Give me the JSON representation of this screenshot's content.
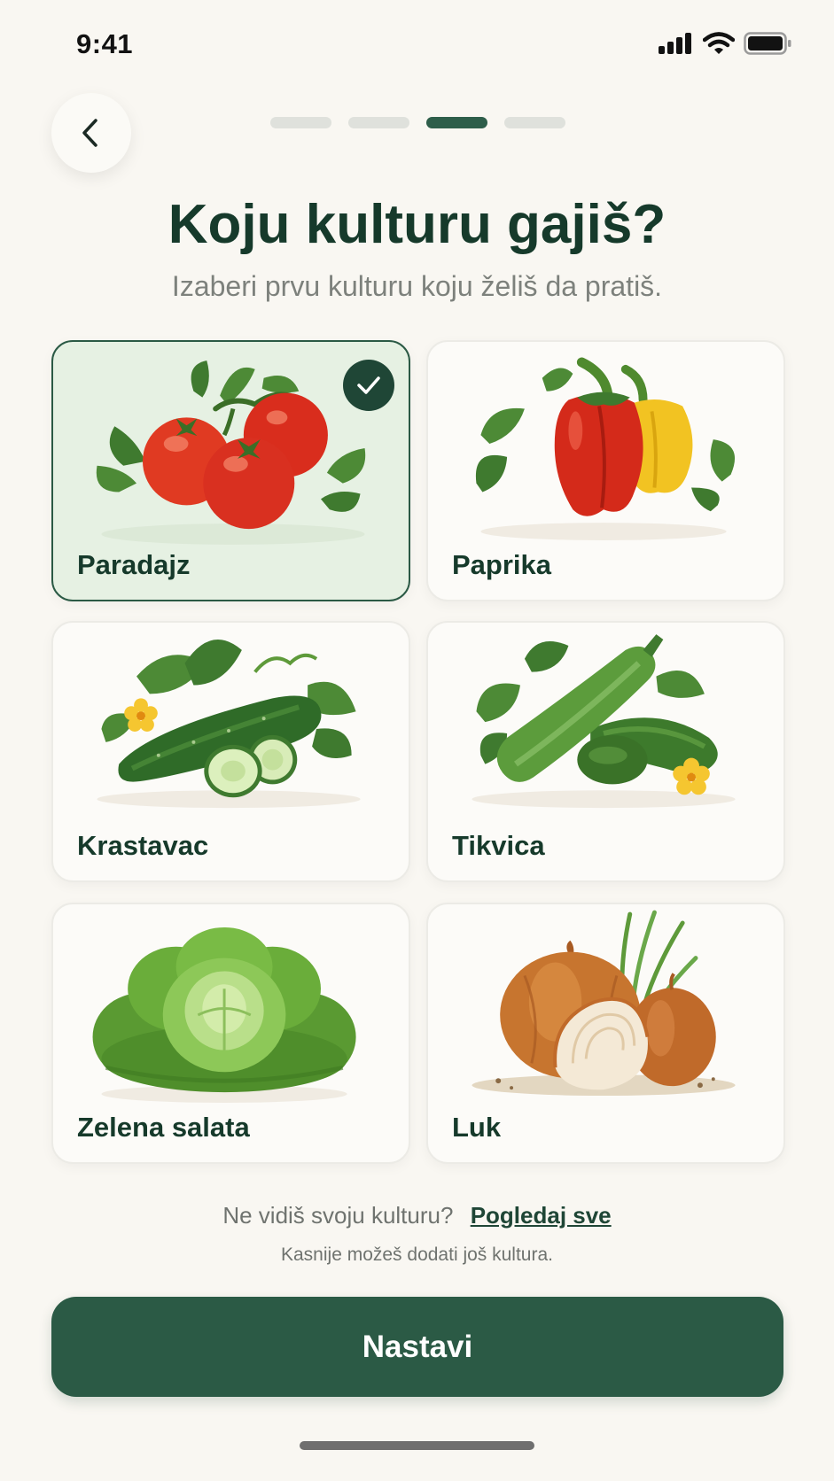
{
  "status_bar": {
    "time": "9:41"
  },
  "progress": {
    "total_steps": 4,
    "current_step": 3
  },
  "header": {
    "title": "Koju kulturu gajiš?",
    "subtitle": "Izaberi prvu kulturu koju želiš da pratiš."
  },
  "crops": [
    {
      "label": "Paradajz",
      "icon": "tomato-icon",
      "selected": true
    },
    {
      "label": "Paprika",
      "icon": "pepper-icon",
      "selected": false
    },
    {
      "label": "Krastavac",
      "icon": "cucumber-icon",
      "selected": false
    },
    {
      "label": "Tikvica",
      "icon": "zucchini-icon",
      "selected": false
    },
    {
      "label": "Zelena salata",
      "icon": "lettuce-icon",
      "selected": false
    },
    {
      "label": "Luk",
      "icon": "onion-icon",
      "selected": false
    }
  ],
  "footer": {
    "question": "Ne vidiš svoju kulturu?",
    "link": "Pogledaj sve",
    "hint": "Kasnije možeš dodati još kultura.",
    "continue_label": "Nastavi"
  },
  "colors": {
    "background": "#f9f7f2",
    "primary": "#2b5a45",
    "selected_card": "#e6f1e3",
    "text": "#163a2b",
    "muted": "#7d817c"
  }
}
